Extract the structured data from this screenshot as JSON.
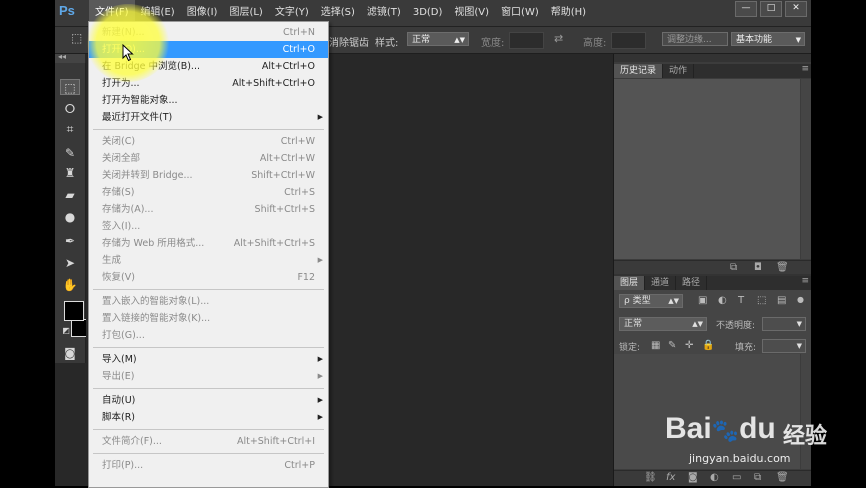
{
  "app": {
    "logo": "Ps"
  },
  "menubar": {
    "items": [
      "文件(F)",
      "编辑(E)",
      "图像(I)",
      "图层(L)",
      "文字(Y)",
      "选择(S)",
      "滤镜(T)",
      "3D(D)",
      "视图(V)",
      "窗口(W)",
      "帮助(H)"
    ],
    "active_index": 0
  },
  "window_controls": {
    "minimize": "—",
    "restore": "□",
    "close": "✕"
  },
  "optionsbar": {
    "antialias": "消除锯齿",
    "style_label": "样式:",
    "style_value": "正常",
    "width_label": "宽度:",
    "height_label": "高度:",
    "refine_edge": "调整边缘...",
    "workspace": "基本功能"
  },
  "history_panel": {
    "tabs": [
      "历史记录",
      "动作"
    ]
  },
  "layers_panel": {
    "tabs": [
      "图层",
      "通道",
      "路径"
    ],
    "filter_kind": "ρ 类型",
    "blend_mode": "正常",
    "opacity_label": "不透明度:",
    "lock_label": "锁定:",
    "fill_label": "填充:"
  },
  "file_menu": {
    "items": [
      {
        "label": "新建(N)...",
        "shortcut": "Ctrl+N",
        "disabled": true
      },
      {
        "label": "打开(O)...",
        "shortcut": "Ctrl+O",
        "highlighted": true
      },
      {
        "label": "在 Bridge 中浏览(B)...",
        "shortcut": "Alt+Ctrl+O"
      },
      {
        "label": "打开为...",
        "shortcut": "Alt+Shift+Ctrl+O"
      },
      {
        "label": "打开为智能对象...",
        "shortcut": ""
      },
      {
        "label": "最近打开文件(T)",
        "shortcut": "",
        "submenu": true
      },
      {
        "separator": true
      },
      {
        "label": "关闭(C)",
        "shortcut": "Ctrl+W",
        "disabled": true
      },
      {
        "label": "关闭全部",
        "shortcut": "Alt+Ctrl+W",
        "disabled": true
      },
      {
        "label": "关闭并转到 Bridge...",
        "shortcut": "Shift+Ctrl+W",
        "disabled": true
      },
      {
        "label": "存储(S)",
        "shortcut": "Ctrl+S",
        "disabled": true
      },
      {
        "label": "存储为(A)...",
        "shortcut": "Shift+Ctrl+S",
        "disabled": true
      },
      {
        "label": "签入(I)...",
        "shortcut": "",
        "disabled": true
      },
      {
        "label": "存储为 Web 所用格式...",
        "shortcut": "Alt+Shift+Ctrl+S",
        "disabled": true
      },
      {
        "label": "生成",
        "shortcut": "",
        "submenu": true,
        "disabled": true
      },
      {
        "label": "恢复(V)",
        "shortcut": "F12",
        "disabled": true
      },
      {
        "separator": true
      },
      {
        "label": "置入嵌入的智能对象(L)...",
        "shortcut": "",
        "disabled": true
      },
      {
        "label": "置入链接的智能对象(K)...",
        "shortcut": "",
        "disabled": true
      },
      {
        "label": "打包(G)...",
        "shortcut": "",
        "disabled": true
      },
      {
        "separator": true
      },
      {
        "label": "导入(M)",
        "shortcut": "",
        "submenu": true
      },
      {
        "label": "导出(E)",
        "shortcut": "",
        "submenu": true,
        "disabled": true
      },
      {
        "separator": true
      },
      {
        "label": "自动(U)",
        "shortcut": "",
        "submenu": true
      },
      {
        "label": "脚本(R)",
        "shortcut": "",
        "submenu": true
      },
      {
        "separator": true
      },
      {
        "label": "文件简介(F)...",
        "shortcut": "Alt+Shift+Ctrl+I",
        "disabled": true
      },
      {
        "separator": true
      },
      {
        "label": "打印(P)...",
        "shortcut": "Ctrl+P",
        "disabled": true
      }
    ]
  },
  "watermark": {
    "brand": "Bai",
    "brand2": "du",
    "cn": "经验",
    "url": "jingyan.baidu.com"
  }
}
